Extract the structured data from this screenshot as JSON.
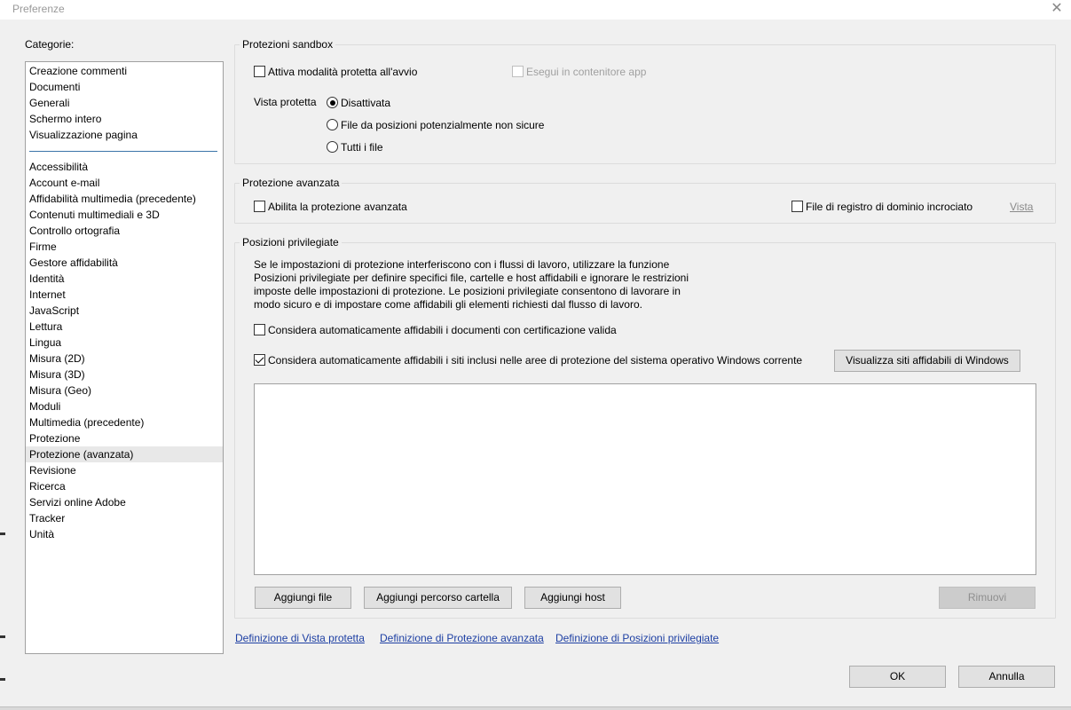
{
  "window": {
    "title": "Preferenze",
    "close_glyph": "✕"
  },
  "categories": {
    "label": "Categorie:",
    "top_items": [
      "Creazione commenti",
      "Documenti",
      "Generali",
      "Schermo intero",
      "Visualizzazione pagina"
    ],
    "items": [
      "Accessibilità",
      "Account e-mail",
      "Affidabilità multimedia (precedente)",
      "Contenuti multimediali e 3D",
      "Controllo ortografia",
      "Firme",
      "Gestore affidabilità",
      "Identità",
      "Internet",
      "JavaScript",
      "Lettura",
      "Lingua",
      "Misura (2D)",
      "Misura (3D)",
      "Misura (Geo)",
      "Moduli",
      "Multimedia (precedente)",
      "Protezione",
      "Protezione (avanzata)",
      "Revisione",
      "Ricerca",
      "Servizi online Adobe",
      "Tracker",
      "Unità"
    ],
    "selected": "Protezione (avanzata)"
  },
  "sandbox": {
    "title": "Protezioni sandbox",
    "protected_mode_label": "Attiva modalità protetta all'avvio",
    "app_container_label": "Esegui in contenitore app",
    "protected_view_label": "Vista protetta",
    "radio_off": "Disattivata",
    "radio_unsafe": "File da posizioni potenzialmente non sicure",
    "radio_all": "Tutti i file"
  },
  "enhanced": {
    "title": "Protezione avanzata",
    "enable_label": "Abilita la protezione avanzata",
    "cross_domain_label": "File di registro di dominio incrociato",
    "view_link": "Vista"
  },
  "privileged": {
    "title": "Posizioni privilegiate",
    "description": [
      "Se le impostazioni di protezione interferiscono con i flussi di lavoro, utilizzare la funzione",
      "Posizioni privilegiate per definire specifici file, cartelle e host affidabili e ignorare le restrizioni",
      "imposte delle impostazioni di protezione. Le posizioni privilegiate consentono di lavorare in",
      "modo sicuro e di impostare come affidabili gli elementi richiesti dal flusso di lavoro."
    ],
    "certified_label": "Considera automaticamente affidabili i documenti con certificazione valida",
    "windows_zones_label": "Considera automaticamente affidabili i siti inclusi nelle aree di protezione del sistema operativo Windows corrente",
    "view_windows_sites_button": "Visualizza siti affidabili di Windows",
    "add_file_button": "Aggiungi file",
    "add_folder_button": "Aggiungi percorso cartella",
    "add_host_button": "Aggiungi host",
    "remove_button": "Rimuovi"
  },
  "links": {
    "protected_view": "Definizione di Vista protetta",
    "enhanced_security": "Definizione di Protezione avanzata",
    "privileged_locations": "Definizione di Posizioni privilegiate"
  },
  "footer": {
    "ok": "OK",
    "cancel": "Annulla"
  }
}
